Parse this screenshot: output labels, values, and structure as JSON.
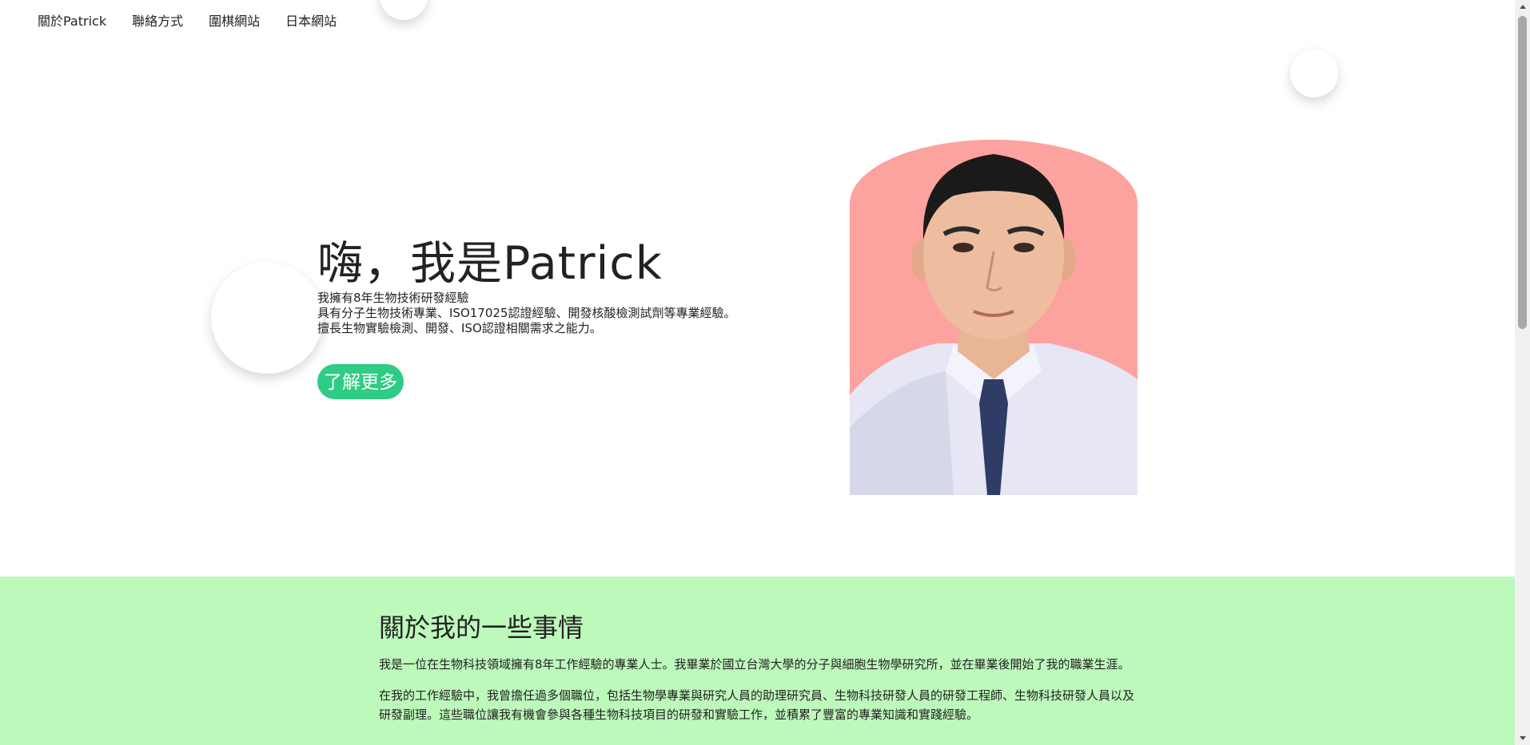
{
  "nav": {
    "items": [
      {
        "label": "關於Patrick"
      },
      {
        "label": "聯絡方式"
      },
      {
        "label": "圍棋網站"
      },
      {
        "label": "日本網站"
      }
    ]
  },
  "hero": {
    "title": "嗨，我是Patrick",
    "lines": [
      "我擁有8年生物技術研發經驗",
      "具有分子生物技術專業、ISO17025認證經驗、開發核酸檢測試劑等專業經驗。",
      "擅長生物實驗檢測、開發、ISO認證相關需求之能力。"
    ],
    "button_label": "了解更多"
  },
  "about": {
    "title": "關於我的一些事情",
    "paragraphs": [
      "我是一位在生物科技領域擁有8年工作經驗的專業人士。我畢業於國立台灣大學的分子與細胞生物學研究所，並在畢業後開始了我的職業生涯。",
      "在我的工作經驗中，我曾擔任過多個職位，包括生物學專業與研究人員的助理研究員、生物科技研發人員的研發工程師、生物科技研發人員以及研發副理。這些職位讓我有機會參與各種生物科技項目的研發和實驗工作，並積累了豐富的專業知識和實踐經驗。"
    ]
  },
  "colors": {
    "accent": "#2ecc85",
    "section_bg": "#bdf9bb",
    "photo_bg": "#fca39f"
  },
  "icons": [
    "scroll-up-arrow-icon",
    "scroll-down-arrow-icon"
  ]
}
